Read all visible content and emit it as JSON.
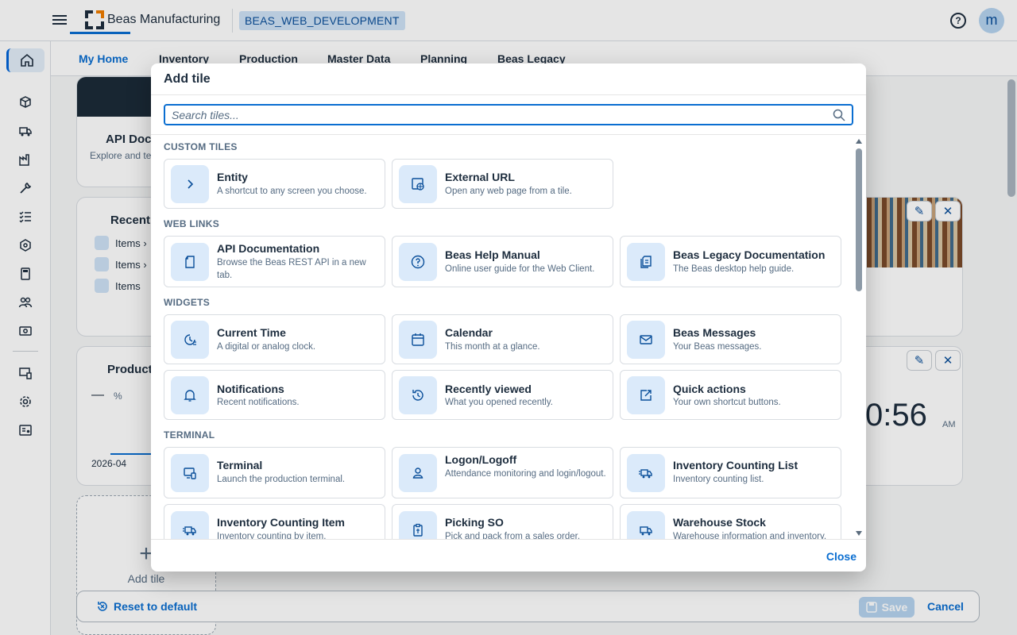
{
  "shell": {
    "brand": "Beas Manufacturing",
    "database": "BEAS_WEB_DEVELOPMENT",
    "help_icon": "?",
    "avatar_initial": "m"
  },
  "tabs": [
    {
      "label": "My Home",
      "active": true
    },
    {
      "label": "Inventory"
    },
    {
      "label": "Production"
    },
    {
      "label": "Master Data"
    },
    {
      "label": "Planning"
    },
    {
      "label": "Beas Legacy"
    }
  ],
  "background": {
    "api_card_title": "API Docu",
    "api_card_sub": "Explore and te",
    "recent_title": "Recently",
    "recent_items": [
      "Items ›",
      "Items ›",
      "Items"
    ],
    "production_title": "Productio",
    "production_value": "—",
    "production_unit": "%",
    "production_date": "2026-04",
    "clock_time": "0:56",
    "clock_ampm": "AM",
    "add_tile_plus": "+",
    "add_tile_label": "Add tile"
  },
  "footer": {
    "reset": "Reset to default",
    "save": "Save",
    "cancel": "Cancel"
  },
  "dialog": {
    "title": "Add tile",
    "search_placeholder": "Search tiles...",
    "close": "Close",
    "sections": {
      "custom": "CUSTOM TILES",
      "web": "WEB LINKS",
      "widgets": "WIDGETS",
      "terminal": "TERMINAL"
    },
    "tiles": {
      "entity": {
        "name": "Entity",
        "desc": "A shortcut to any screen you choose."
      },
      "external_url": {
        "name": "External URL",
        "desc": "Open any web page from a tile."
      },
      "api_doc": {
        "name": "API Documentation",
        "desc": "Browse the Beas REST API in a new tab."
      },
      "help_manual": {
        "name": "Beas Help Manual",
        "desc": "Online user guide for the Web Client."
      },
      "legacy_doc": {
        "name": "Beas Legacy Documentation",
        "desc": "The Beas desktop help guide."
      },
      "current_time": {
        "name": "Current Time",
        "desc": "A digital or analog clock."
      },
      "calendar": {
        "name": "Calendar",
        "desc": "This month at a glance."
      },
      "messages": {
        "name": "Beas Messages",
        "desc": "Your Beas messages."
      },
      "notifications": {
        "name": "Notifications",
        "desc": "Recent notifications."
      },
      "recently_viewed": {
        "name": "Recently viewed",
        "desc": "What you opened recently."
      },
      "quick_actions": {
        "name": "Quick actions",
        "desc": "Your own shortcut buttons."
      },
      "terminal": {
        "name": "Terminal",
        "desc": "Launch the production terminal."
      },
      "logon": {
        "name": "Logon/Logoff",
        "desc": "Attendance monitoring and login/logout."
      },
      "inv_count_list": {
        "name": "Inventory Counting List",
        "desc": "Inventory counting list."
      },
      "inv_count_item": {
        "name": "Inventory Counting Item",
        "desc": "Inventory counting by item."
      },
      "picking_so": {
        "name": "Picking SO",
        "desc": "Pick and pack from a sales order."
      },
      "warehouse_stock": {
        "name": "Warehouse Stock",
        "desc": "Warehouse information and inventory."
      }
    }
  },
  "colors": {
    "accent": "#0a6ed1",
    "tile_icon_bg": "#dbeafa",
    "badge_bg": "#cfe3f7"
  }
}
